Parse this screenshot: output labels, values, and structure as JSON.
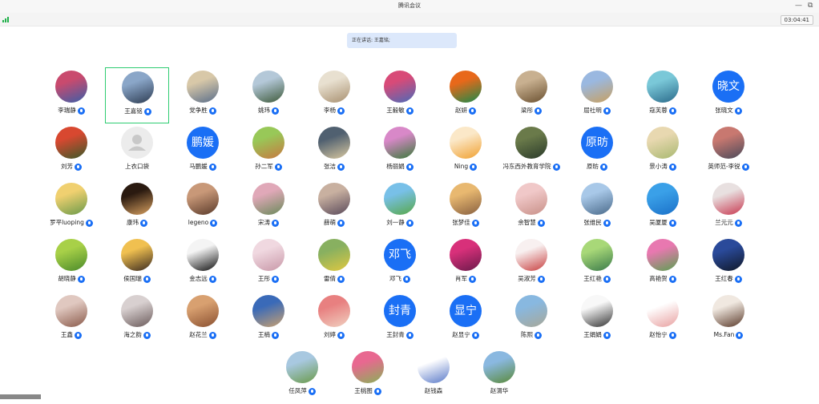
{
  "window": {
    "title": "腾讯会议",
    "minimize_glyph": "—",
    "restore_glyph": "⧉"
  },
  "toolbar": {
    "signal_icon": "signal-strength-icon",
    "timer": "03:04:41"
  },
  "speaking": "正在讲话: 王嘉铭;",
  "colors": {
    "accent": "#1a6ff5",
    "active_border": "#2ecc71",
    "signal": "#22b14c",
    "banner": "#dce8fb"
  },
  "participants": [
    {
      "name": "李瑞静",
      "mic": true,
      "avatar": {
        "type": "photo",
        "colors": [
          "#c94a6e",
          "#3b5ea8"
        ]
      }
    },
    {
      "name": "王嘉铭",
      "mic": true,
      "active": true,
      "avatar": {
        "type": "photo",
        "colors": [
          "#8aa6c8",
          "#2d3c52"
        ]
      }
    },
    {
      "name": "党争胜",
      "mic": true,
      "avatar": {
        "type": "photo",
        "colors": [
          "#d8c8a8",
          "#5a6e8a"
        ]
      }
    },
    {
      "name": "姚玮",
      "mic": true,
      "avatar": {
        "type": "photo",
        "colors": [
          "#b4c8d8",
          "#3e5a3a"
        ]
      }
    },
    {
      "name": "李杨",
      "mic": true,
      "avatar": {
        "type": "photo",
        "colors": [
          "#e8e0d0",
          "#a89070"
        ]
      }
    },
    {
      "name": "王毅敏",
      "mic": true,
      "avatar": {
        "type": "photo",
        "colors": [
          "#d84a78",
          "#4a6ab8"
        ]
      }
    },
    {
      "name": "赵妍",
      "mic": true,
      "avatar": {
        "type": "photo",
        "colors": [
          "#e8681a",
          "#1a8a4a"
        ]
      }
    },
    {
      "name": "梁彤",
      "mic": true,
      "avatar": {
        "type": "photo",
        "colors": [
          "#c8b090",
          "#6a5030"
        ]
      }
    },
    {
      "name": "屈社明",
      "mic": true,
      "avatar": {
        "type": "photo",
        "colors": [
          "#9ab8e0",
          "#c8a060"
        ]
      }
    },
    {
      "name": "寇芙蓉",
      "mic": true,
      "avatar": {
        "type": "photo",
        "colors": [
          "#7ac8d8",
          "#2a6a8a"
        ]
      }
    },
    {
      "name": "张晓文",
      "mic": true,
      "avatar": {
        "type": "text",
        "text": "晓文"
      }
    },
    {
      "name": "刘芳",
      "mic": true,
      "avatar": {
        "type": "photo",
        "colors": [
          "#d84830",
          "#3a5a2a"
        ]
      }
    },
    {
      "name": "上衣口袋",
      "mic": false,
      "avatar": {
        "type": "empty"
      }
    },
    {
      "name": "马鹏媛",
      "mic": true,
      "avatar": {
        "type": "text",
        "text": "鹏媛"
      }
    },
    {
      "name": "孙二军",
      "mic": true,
      "avatar": {
        "type": "photo",
        "colors": [
          "#98c858",
          "#c87840"
        ]
      }
    },
    {
      "name": "张洁",
      "mic": true,
      "avatar": {
        "type": "photo",
        "colors": [
          "#506070",
          "#d8c8a0"
        ]
      }
    },
    {
      "name": "杨丽娟",
      "mic": true,
      "avatar": {
        "type": "photo",
        "colors": [
          "#d888c8",
          "#3a7a3a"
        ]
      }
    },
    {
      "name": "Ning",
      "mic": true,
      "avatar": {
        "type": "photo",
        "colors": [
          "#fbe8c8",
          "#f0a030"
        ]
      }
    },
    {
      "name": "冯东西外教育学院",
      "mic": true,
      "avatar": {
        "type": "photo",
        "colors": [
          "#6a7a4a",
          "#2a3a2a"
        ]
      }
    },
    {
      "name": "原昉",
      "mic": true,
      "avatar": {
        "type": "text",
        "text": "原昉"
      }
    },
    {
      "name": "景小涛",
      "mic": true,
      "avatar": {
        "type": "photo",
        "colors": [
          "#e8d8b0",
          "#a8b870"
        ]
      }
    },
    {
      "name": "英师范-李锐",
      "mic": true,
      "avatar": {
        "type": "photo",
        "colors": [
          "#c87870",
          "#4a4a5a"
        ]
      }
    },
    {
      "name": "罗平luoping",
      "mic": true,
      "avatar": {
        "type": "photo",
        "colors": [
          "#f0d070",
          "#6a9a4a"
        ]
      }
    },
    {
      "name": "康玮",
      "mic": true,
      "avatar": {
        "type": "photo",
        "colors": [
          "#2a1a10",
          "#d8a060"
        ]
      }
    },
    {
      "name": "legeno",
      "mic": true,
      "avatar": {
        "type": "photo",
        "colors": [
          "#c89878",
          "#5a3a2a"
        ]
      }
    },
    {
      "name": "宋涛",
      "mic": true,
      "avatar": {
        "type": "photo",
        "colors": [
          "#e0a8b8",
          "#6a8a5a"
        ]
      }
    },
    {
      "name": "薛萌",
      "mic": true,
      "avatar": {
        "type": "photo",
        "colors": [
          "#c8b0a0",
          "#5a4a5a"
        ]
      }
    },
    {
      "name": "刘一静",
      "mic": true,
      "avatar": {
        "type": "photo",
        "colors": [
          "#78c0e8",
          "#58a848"
        ]
      }
    },
    {
      "name": "张梦佳",
      "mic": true,
      "avatar": {
        "type": "photo",
        "colors": [
          "#e8b870",
          "#886040"
        ]
      }
    },
    {
      "name": "余智慧",
      "mic": true,
      "avatar": {
        "type": "photo",
        "colors": [
          "#f0c8c8",
          "#c89088"
        ]
      }
    },
    {
      "name": "张维民",
      "mic": true,
      "avatar": {
        "type": "photo",
        "colors": [
          "#a8c8e8",
          "#4a6a8a"
        ]
      }
    },
    {
      "name": "吴厦厦",
      "mic": true,
      "avatar": {
        "type": "photo",
        "colors": [
          "#3aa0e8",
          "#1a70c8"
        ]
      }
    },
    {
      "name": "兰元元",
      "mic": true,
      "avatar": {
        "type": "photo",
        "colors": [
          "#e8e0e0",
          "#c83850"
        ]
      }
    },
    {
      "name": "胡晓静",
      "mic": true,
      "avatar": {
        "type": "photo",
        "colors": [
          "#a8d048",
          "#4a8a2a"
        ]
      }
    },
    {
      "name": "侯国瑞",
      "mic": true,
      "avatar": {
        "type": "photo",
        "colors": [
          "#f0c050",
          "#3a2a20"
        ]
      }
    },
    {
      "name": "金志远",
      "mic": true,
      "avatar": {
        "type": "photo",
        "colors": [
          "#f4f4f4",
          "#111111"
        ]
      }
    },
    {
      "name": "王彤",
      "mic": true,
      "avatar": {
        "type": "photo",
        "colors": [
          "#f0d8e0",
          "#c898a8"
        ]
      }
    },
    {
      "name": "雷倩",
      "mic": true,
      "avatar": {
        "type": "photo",
        "colors": [
          "#88b060",
          "#e0c840"
        ]
      }
    },
    {
      "name": "邓飞",
      "mic": true,
      "avatar": {
        "type": "text",
        "text": "邓飞"
      }
    },
    {
      "name": "肖军",
      "mic": true,
      "avatar": {
        "type": "photo",
        "colors": [
          "#d8307a",
          "#6a1a4a"
        ]
      }
    },
    {
      "name": "吴淑芳",
      "mic": true,
      "avatar": {
        "type": "photo",
        "colors": [
          "#f8f0f0",
          "#c84040"
        ]
      }
    },
    {
      "name": "王红艳",
      "mic": true,
      "avatar": {
        "type": "photo",
        "colors": [
          "#a8d878",
          "#3a7a4a"
        ]
      }
    },
    {
      "name": "高艳贺",
      "mic": true,
      "avatar": {
        "type": "photo",
        "colors": [
          "#e878b0",
          "#5aa050"
        ]
      }
    },
    {
      "name": "王红春",
      "mic": true,
      "avatar": {
        "type": "photo",
        "colors": [
          "#2a4a9a",
          "#101828"
        ]
      }
    },
    {
      "name": "王鑫",
      "mic": true,
      "avatar": {
        "type": "photo",
        "colors": [
          "#e0c8c0",
          "#8a5a4a"
        ]
      }
    },
    {
      "name": "海之韵",
      "mic": true,
      "avatar": {
        "type": "photo",
        "colors": [
          "#d8d0d0",
          "#6a5a5a"
        ]
      }
    },
    {
      "name": "赵花兰",
      "mic": true,
      "avatar": {
        "type": "photo",
        "colors": [
          "#d8a070",
          "#8a5030"
        ]
      }
    },
    {
      "name": "王楠",
      "mic": true,
      "avatar": {
        "type": "photo",
        "colors": [
          "#3a6ab8",
          "#c8a070"
        ]
      }
    },
    {
      "name": "刘婷",
      "mic": true,
      "avatar": {
        "type": "photo",
        "colors": [
          "#e88080",
          "#f0d0c0"
        ]
      }
    },
    {
      "name": "王封青",
      "mic": true,
      "avatar": {
        "type": "text",
        "text": "封青"
      }
    },
    {
      "name": "赵显宁",
      "mic": true,
      "avatar": {
        "type": "text",
        "text": "显宁"
      }
    },
    {
      "name": "陈熙",
      "mic": true,
      "avatar": {
        "type": "photo",
        "colors": [
          "#88b8e0",
          "#a8a898"
        ]
      }
    },
    {
      "name": "王娟娟",
      "mic": true,
      "avatar": {
        "type": "photo",
        "colors": [
          "#f8f8f8",
          "#333333"
        ]
      }
    },
    {
      "name": "赵怡宁",
      "mic": true,
      "avatar": {
        "type": "photo",
        "colors": [
          "#ffffff",
          "#e8a0a0"
        ]
      }
    },
    {
      "name": "Ms.Fan",
      "mic": true,
      "avatar": {
        "type": "photo",
        "colors": [
          "#f0e8e0",
          "#5a3a2a"
        ]
      }
    },
    {
      "name": "任凤萍",
      "mic": true,
      "avatar": {
        "type": "photo",
        "colors": [
          "#a8c8e0",
          "#6a9a4a"
        ]
      }
    },
    {
      "name": "王桃图",
      "mic": true,
      "avatar": {
        "type": "photo",
        "colors": [
          "#e86890",
          "#8ab058"
        ]
      }
    },
    {
      "name": "赵钱森",
      "mic": false,
      "avatar": {
        "type": "photo",
        "colors": [
          "#ffffff",
          "#5a7ac8"
        ]
      }
    },
    {
      "name": "赵渭华",
      "mic": false,
      "avatar": {
        "type": "photo",
        "colors": [
          "#8ab8e0",
          "#5a8a3a"
        ]
      }
    }
  ]
}
